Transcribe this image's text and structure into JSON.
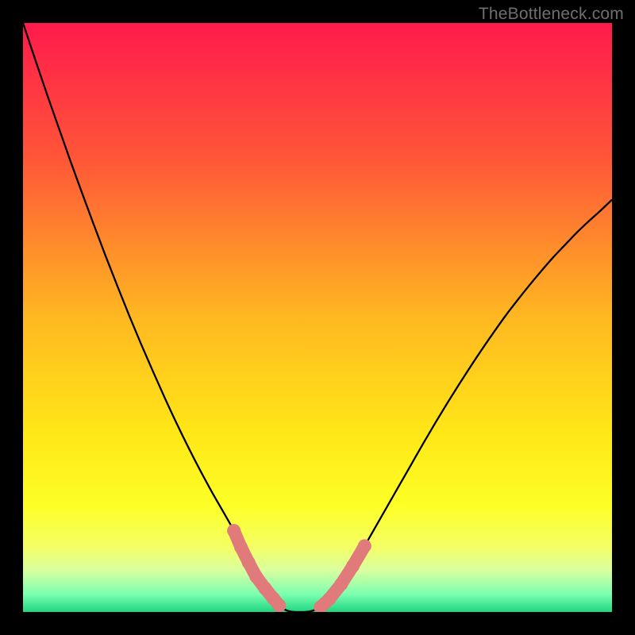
{
  "watermark": "TheBottleneck.com",
  "chart_data": {
    "type": "line",
    "title": "",
    "xlabel": "",
    "ylabel": "",
    "xlim": [
      0,
      100
    ],
    "ylim": [
      0,
      100
    ],
    "x": [
      0,
      2,
      4,
      6,
      8,
      10,
      12,
      14,
      16,
      18,
      20,
      22,
      24,
      26,
      28,
      30,
      32,
      34,
      35.8,
      37,
      38.3,
      39.6,
      41.1,
      42.5,
      43.5,
      44.5,
      45.5,
      46.5,
      47.5,
      48.5,
      49.5,
      50.5,
      52,
      54,
      56,
      58,
      60,
      62,
      64,
      66,
      68,
      70,
      72,
      74,
      76,
      78,
      80,
      82,
      84,
      86,
      88,
      90,
      92,
      94,
      96,
      98,
      100
    ],
    "series": [
      {
        "name": "curve",
        "values": [
          100,
          94.0,
          88.1,
          82.4,
          76.7,
          71.2,
          65.8,
          60.5,
          55.4,
          50.4,
          45.6,
          41.0,
          36.5,
          32.2,
          28.1,
          24.2,
          20.5,
          17.0,
          13.8,
          11.0,
          8.4,
          6.0,
          4.0,
          2.3,
          1.1,
          0.38,
          0.06,
          0.0,
          0.0,
          0.06,
          0.32,
          0.81,
          2.2,
          4.7,
          7.8,
          11.2,
          14.7,
          18.2,
          21.7,
          25.2,
          28.7,
          32.1,
          35.4,
          38.6,
          41.7,
          44.7,
          47.6,
          50.4,
          53.0,
          55.5,
          57.9,
          60.2,
          62.3,
          64.4,
          66.3,
          68.1,
          70.0
        ]
      }
    ],
    "highlight": {
      "left": [
        {
          "x": 35.8,
          "y": 13.8
        },
        {
          "x": 37.0,
          "y": 11.0
        },
        {
          "x": 38.3,
          "y": 8.4
        },
        {
          "x": 39.6,
          "y": 6.0
        },
        {
          "x": 41.1,
          "y": 4.0
        },
        {
          "x": 42.5,
          "y": 2.3
        },
        {
          "x": 43.5,
          "y": 1.1
        }
      ],
      "right": [
        {
          "x": 50.5,
          "y": 0.81
        },
        {
          "x": 52.0,
          "y": 2.2
        },
        {
          "x": 54.0,
          "y": 4.7
        },
        {
          "x": 56.0,
          "y": 7.8
        },
        {
          "x": 58.0,
          "y": 11.2
        }
      ]
    },
    "gradient_stops": [
      {
        "offset": 0.0,
        "color": "#ff1a4c"
      },
      {
        "offset": 0.23,
        "color": "#ff5638"
      },
      {
        "offset": 0.5,
        "color": "#ffb821"
      },
      {
        "offset": 0.7,
        "color": "#ffe817"
      },
      {
        "offset": 0.82,
        "color": "#fdff27"
      },
      {
        "offset": 0.89,
        "color": "#f4ff65"
      },
      {
        "offset": 0.93,
        "color": "#d8ffa0"
      },
      {
        "offset": 0.97,
        "color": "#7bffb0"
      },
      {
        "offset": 1.0,
        "color": "#1fd681"
      }
    ],
    "curve_color": "#000000",
    "highlight_color": "#e17a7a",
    "grid": false,
    "legend": false
  }
}
